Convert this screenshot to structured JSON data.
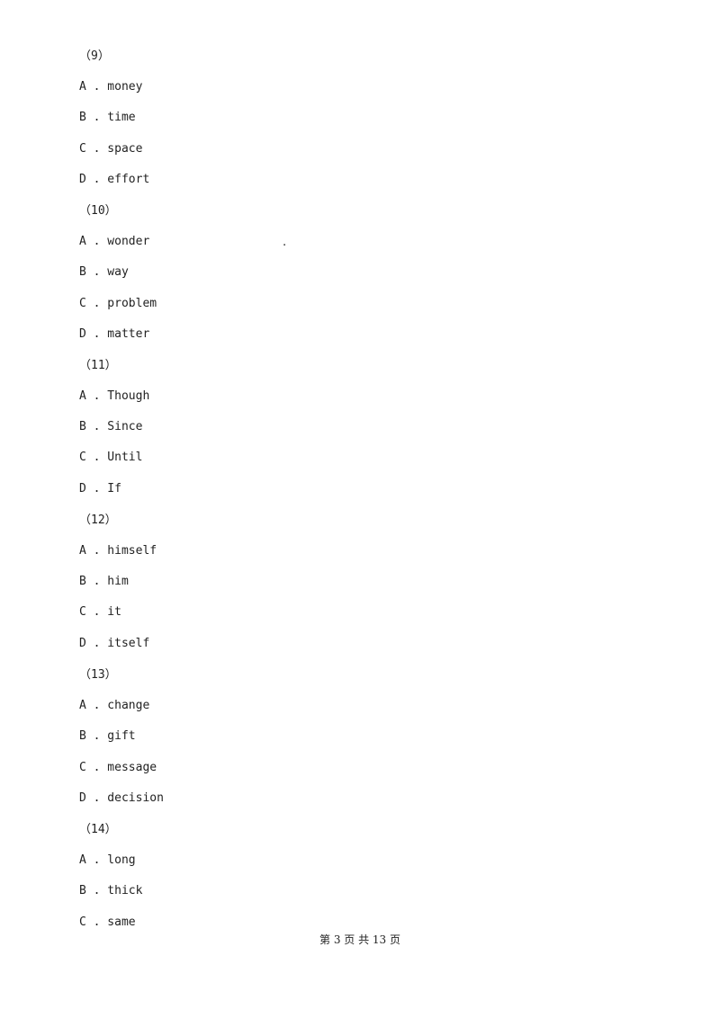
{
  "questions": [
    {
      "number": "（9）",
      "options": [
        "A . money",
        "B . time",
        "C . space",
        "D . effort"
      ]
    },
    {
      "number": "（10）",
      "options": [
        "A . wonder",
        "B . way",
        "C . problem",
        "D . matter"
      ]
    },
    {
      "number": "（11）",
      "options": [
        "A . Though",
        "B . Since",
        "C . Until",
        "D . If"
      ]
    },
    {
      "number": "（12）",
      "options": [
        "A . himself",
        "B . him",
        "C . it",
        "D . itself"
      ]
    },
    {
      "number": "（13）",
      "options": [
        "A . change",
        "B . gift",
        "C . message",
        "D . decision"
      ]
    },
    {
      "number": "（14）",
      "options": [
        "A . long",
        "B . thick",
        "C . same"
      ]
    }
  ],
  "stray_mark": ".",
  "footer": "第 3 页 共 13 页"
}
